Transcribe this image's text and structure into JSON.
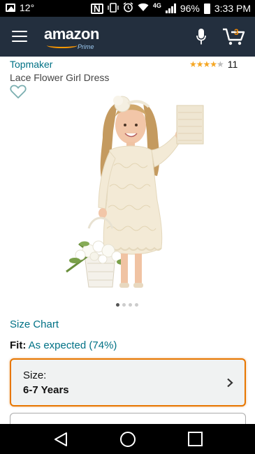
{
  "status_bar": {
    "temperature": "12°",
    "network": "4G",
    "battery": "96%",
    "time": "3:33 PM"
  },
  "nav": {
    "logo_text": "amazon",
    "logo_sub": "Prime",
    "cart_count": "3"
  },
  "product": {
    "brand": "Topmaker",
    "title": "Lace Flower Girl Dress",
    "rating_stars": 4.0,
    "rating_count": "11",
    "image_index": 1,
    "image_total": 4
  },
  "size_chart_link": "Size Chart",
  "fit": {
    "label": "Fit:",
    "value": "As expected (74%)"
  },
  "size_selector": {
    "label": "Size:",
    "value": "6-7 Years"
  },
  "colors": {
    "nav_bg": "#232f3e",
    "link": "#007185",
    "accent": "#e77600",
    "star": "#f5a623"
  },
  "icons": [
    "image-icon",
    "nfc-icon",
    "vibrate-icon",
    "alarm-icon",
    "wifi-icon",
    "signal-icon",
    "battery-icon",
    "menu-icon",
    "microphone-icon",
    "cart-icon",
    "heart-icon",
    "chevron-right-icon",
    "back-icon",
    "home-icon",
    "recents-icon"
  ]
}
